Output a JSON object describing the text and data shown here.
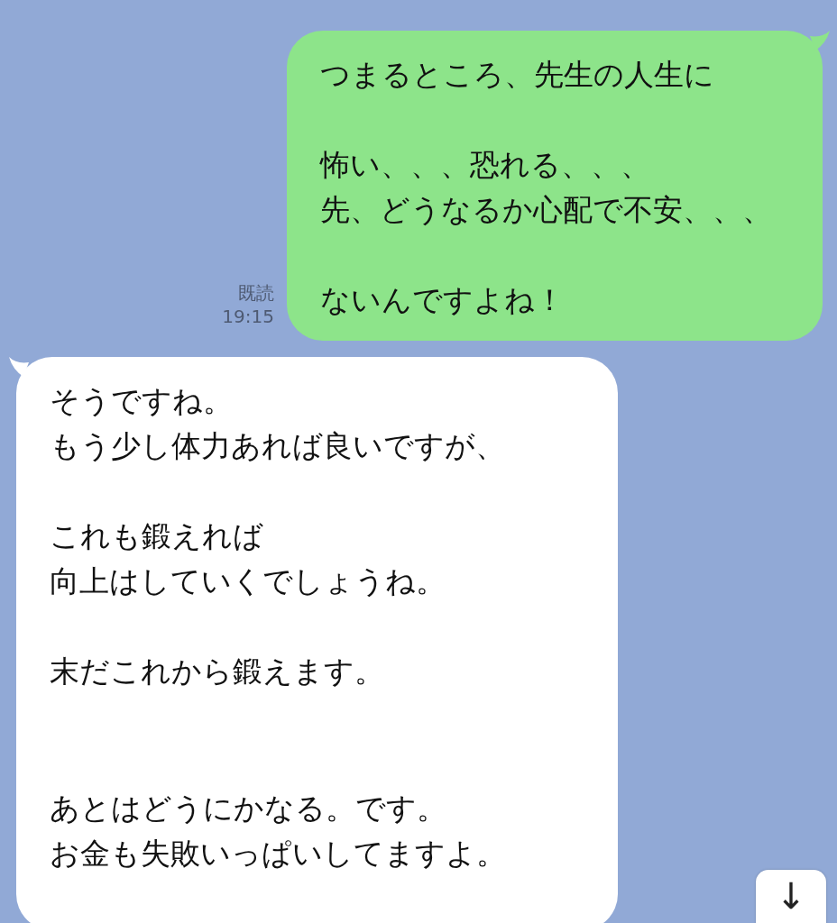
{
  "sent_message": {
    "read_status": "既読",
    "time": "19:15",
    "paragraphs": [
      [
        "つまるところ、先生の人生に"
      ],
      [
        "怖い、、、恐れる、、、",
        "先、どうなるか心配で不安、、、"
      ],
      [
        "ないんですよね！"
      ]
    ]
  },
  "received_message": {
    "paragraphs": [
      [
        "そうですね。",
        "もう少し体力あれば良いですが、"
      ],
      [
        "これも鍛えれば",
        "向上はしていくでしょうね。"
      ],
      [
        "末だこれから鍛えます。"
      ],
      [
        "あとはどうにかなる。です。",
        "お金も失敗いっぱいしてますよ。"
      ]
    ]
  },
  "scroll_button": {
    "label": "↓"
  }
}
